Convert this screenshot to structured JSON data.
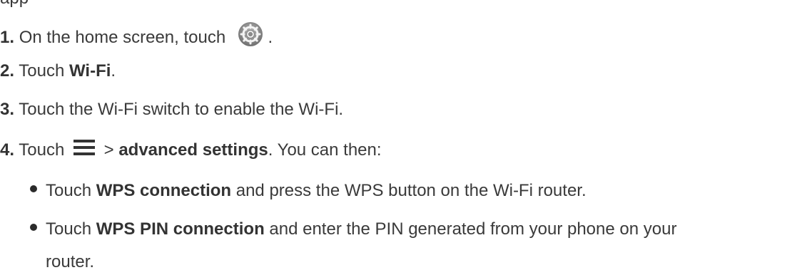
{
  "top_partial": "app",
  "steps": [
    {
      "num": "1.",
      "text_before": "On the home screen, touch",
      "text_after": " ."
    },
    {
      "num": "2.",
      "text_before": "Touch ",
      "bold": "Wi-Fi",
      "text_after": "."
    },
    {
      "num": "3.",
      "text_before": "Touch the Wi-Fi switch to enable the Wi-Fi."
    },
    {
      "num": "4.",
      "text_before": "Touch",
      "sep": ">",
      "bold": "advanced settings",
      "text_after": ". You can then:"
    }
  ],
  "bullets": [
    {
      "text_before": "Touch ",
      "bold": "WPS connection",
      "text_after": " and press the WPS button on the Wi-Fi router."
    },
    {
      "text_before": "Touch ",
      "bold": "WPS PIN connection",
      "text_after": " and enter the PIN generated from your phone on your",
      "continuation": "router."
    }
  ],
  "icons": {
    "settings": "gear-icon",
    "menu": "menu-icon"
  },
  "colors": {
    "text": "#3a3a3a",
    "icon_gray": "#8a8a8a"
  }
}
